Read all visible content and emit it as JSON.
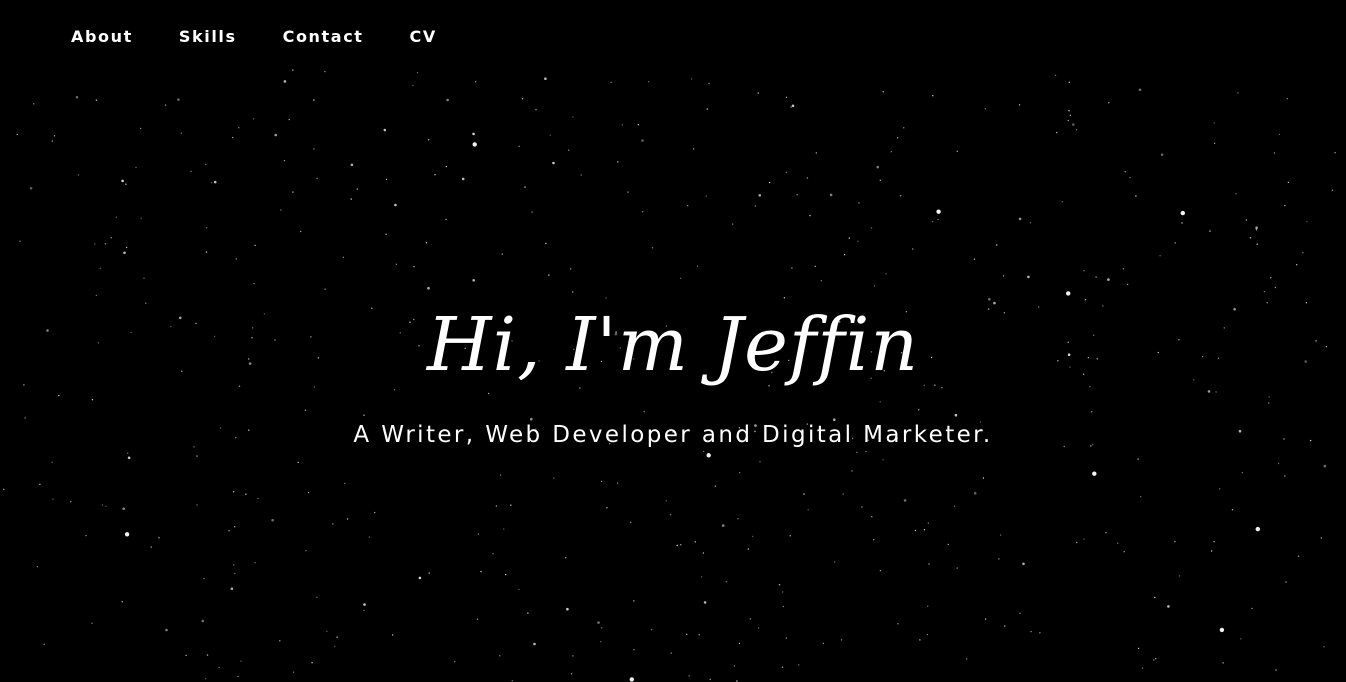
{
  "nav": {
    "items": [
      {
        "label": "About"
      },
      {
        "label": "Skills"
      },
      {
        "label": "Contact"
      },
      {
        "label": "CV"
      }
    ]
  },
  "hero": {
    "title": "Hi, I'm Jeffin",
    "subtitle": "A Writer, Web Developer and Digital Marketer."
  },
  "colors": {
    "background": "#000000",
    "text": "#ffffff",
    "stars": "#ffffff"
  }
}
